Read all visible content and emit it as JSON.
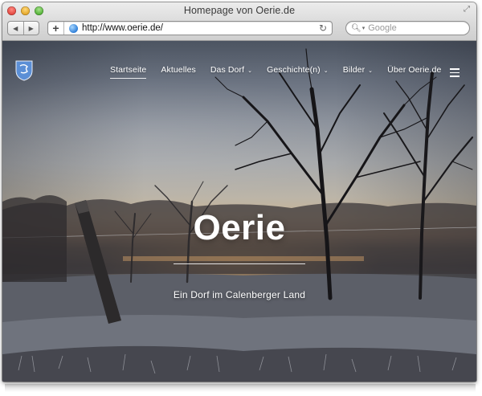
{
  "browser": {
    "window_title": "Homepage von Oerie.de",
    "url": "http://www.oerie.de/",
    "search_placeholder": "Google",
    "back_glyph": "◀",
    "forward_glyph": "▶",
    "plus_glyph": "+",
    "reload_glyph": "↻",
    "fullscreen_glyph": "⤢"
  },
  "site": {
    "logo_icon": "coat-of-arms-icon",
    "nav": [
      {
        "label": "Startseite",
        "active": true,
        "dropdown": false
      },
      {
        "label": "Aktuelles",
        "active": false,
        "dropdown": false
      },
      {
        "label": "Das Dorf",
        "active": false,
        "dropdown": true
      },
      {
        "label": "Geschichte(n)",
        "active": false,
        "dropdown": true
      },
      {
        "label": "Bilder",
        "active": false,
        "dropdown": true
      },
      {
        "label": "Über Oerie.de",
        "active": false,
        "dropdown": false
      }
    ],
    "chevron_glyph": "⌄",
    "menu_icon": "hamburger-menu-icon",
    "hero": {
      "title": "Oerie",
      "subtitle": "Ein Dorf im Calenberger Land"
    }
  },
  "colors": {
    "accent_link": "#ffffff",
    "logo_blue": "#5b8fd6",
    "close": "#e0443e",
    "minimize": "#e1a325",
    "maximize": "#4fae33"
  }
}
